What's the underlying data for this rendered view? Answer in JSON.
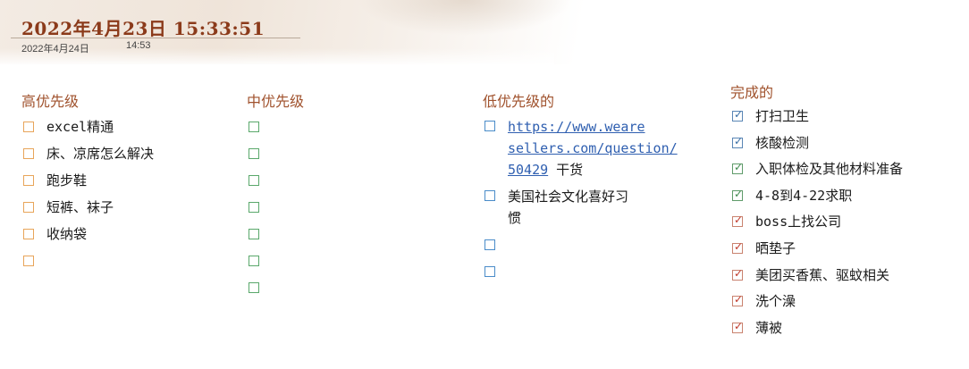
{
  "header": {
    "title": "2022年4月23日  15:33:51",
    "date": "2022年4月24日",
    "time": "14:53"
  },
  "colors": {
    "title": "#8b3a1a",
    "heading": "#a0522d",
    "high_box": "#e8a55a",
    "mid_box": "#5aa86b",
    "low_box": "#4a8cc9",
    "link": "#2f5fb0",
    "check_red": "#c0392b"
  },
  "columns": {
    "high": {
      "heading": "高优先级",
      "items": [
        "excel精通",
        "床、凉席怎么解决",
        "跑步鞋",
        "短裤、袜子",
        "收纳袋",
        ""
      ]
    },
    "mid": {
      "heading": "中优先级",
      "items": [
        "",
        "",
        "",
        "",
        "",
        "",
        ""
      ]
    },
    "low": {
      "heading": "低优先级的",
      "items": [
        {
          "link_line1": "https://www.weare",
          "link_line2": "sellers.com/question/",
          "link_line3": "50429",
          "suffix": " 干货"
        },
        {
          "line1": "美国社会文化喜好习",
          "line2": "惯"
        },
        {
          "text": ""
        },
        {
          "text": ""
        }
      ]
    },
    "done": {
      "heading": "完成的",
      "items": [
        "打扫卫生",
        "核酸检测",
        "入职体检及其他材料准备",
        "4-8到4-22求职",
        "boss上找公司",
        "晒垫子",
        "美团买香蕉、驱蚊相关",
        "洗个澡",
        "薄被"
      ],
      "check_icon": "checkmark"
    }
  }
}
